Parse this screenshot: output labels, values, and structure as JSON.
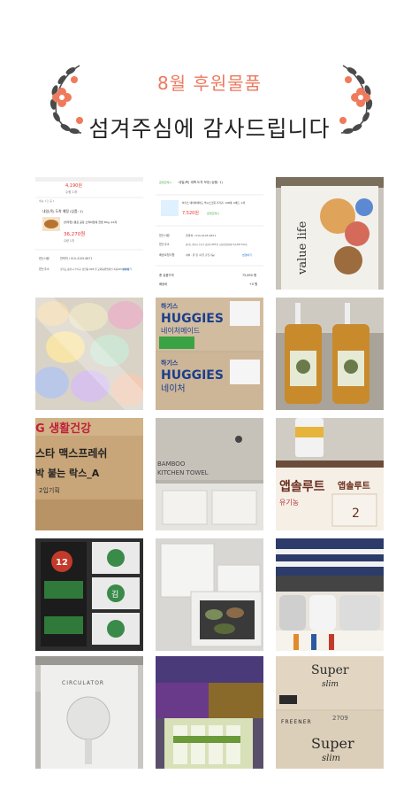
{
  "header": {
    "title": "8월 후원물품",
    "subtitle": "섬겨주심에 감사드립니다"
  },
  "colors": {
    "title": "#ec7a5f",
    "flower": "#f07a5c",
    "leaf": "#4a4a4a"
  },
  "tiles": [
    {
      "name": "order-receipt-1",
      "price_top": "4,190원",
      "qty_top": "수량 1개",
      "section": "배송 2건 중 1",
      "delivery": "내일(목) 도착 예정 (상품: 1)",
      "item": "[블루탑] 쌀로 공장 소떡하임에 찬밥 80g, 24개",
      "price": "36,270원",
      "qty": "수량 1개",
      "labels": [
        "받는사람",
        "받는주소"
      ],
      "phone": "연락처 / 010-4105-6671",
      "address": "경기도 용인시 수지구 상현동 828 번 교회동원엄마인 4층205 102호",
      "change": "변경하기"
    },
    {
      "name": "order-receipt-2",
      "badge": "로켓프레시",
      "delivery": "내일(목) 새벽 도착 보장 (상품: 1)",
      "item": "하기스 네이처메이드 맥시스크림 기저귀, 140매, 4세트, 1개",
      "price": "7,520원",
      "badge2": "로켓프레시",
      "labels": [
        "받는사람",
        "받는주소",
        "배송요청사항"
      ],
      "phone": "연락처 / 010-4105-6671",
      "address": "경기도 용인시 수지구 상현동 828 번 교회동원엄마인 4층205 102호",
      "request": "새벽 : 문 앞 (자유 출입가능)",
      "change": "변경하기",
      "total_label": "총 상품가격",
      "total": "75,690 원",
      "ship_label": "배송비",
      "ship": "+0 원"
    },
    {
      "name": "photo-value-life-bag",
      "texts": [
        "value life"
      ]
    },
    {
      "name": "photo-pastel-soaps"
    },
    {
      "name": "photo-huggies-boxes",
      "texts": [
        "하기스",
        "HUGGIES",
        "네이처메이드",
        "하기스",
        "HUGGIES",
        "네이처"
      ]
    },
    {
      "name": "photo-soap-bottles"
    },
    {
      "name": "photo-lg-box",
      "texts": [
        "G 생활건강",
        "스타 맥스프레쉬",
        "박 붙는 락스_A",
        "2입기획"
      ]
    },
    {
      "name": "photo-kitchen-towel",
      "texts": [
        "BAMBOO",
        "KITCHEN TOWEL"
      ]
    },
    {
      "name": "photo-absolute-formula",
      "texts": [
        "앱솔루트",
        "앱솔루트",
        "유기농",
        "2"
      ]
    },
    {
      "name": "photo-seaweed-packs",
      "texts": [
        "12",
        "김"
      ]
    },
    {
      "name": "photo-styrofoam-box"
    },
    {
      "name": "photo-socks"
    },
    {
      "name": "photo-circulator",
      "texts": [
        "CIRCULATOR"
      ]
    },
    {
      "name": "photo-drink-boxes"
    },
    {
      "name": "photo-super-slim",
      "texts": [
        "Super",
        "slim",
        "FREENER",
        "Super",
        "slim",
        "2709"
      ]
    }
  ]
}
